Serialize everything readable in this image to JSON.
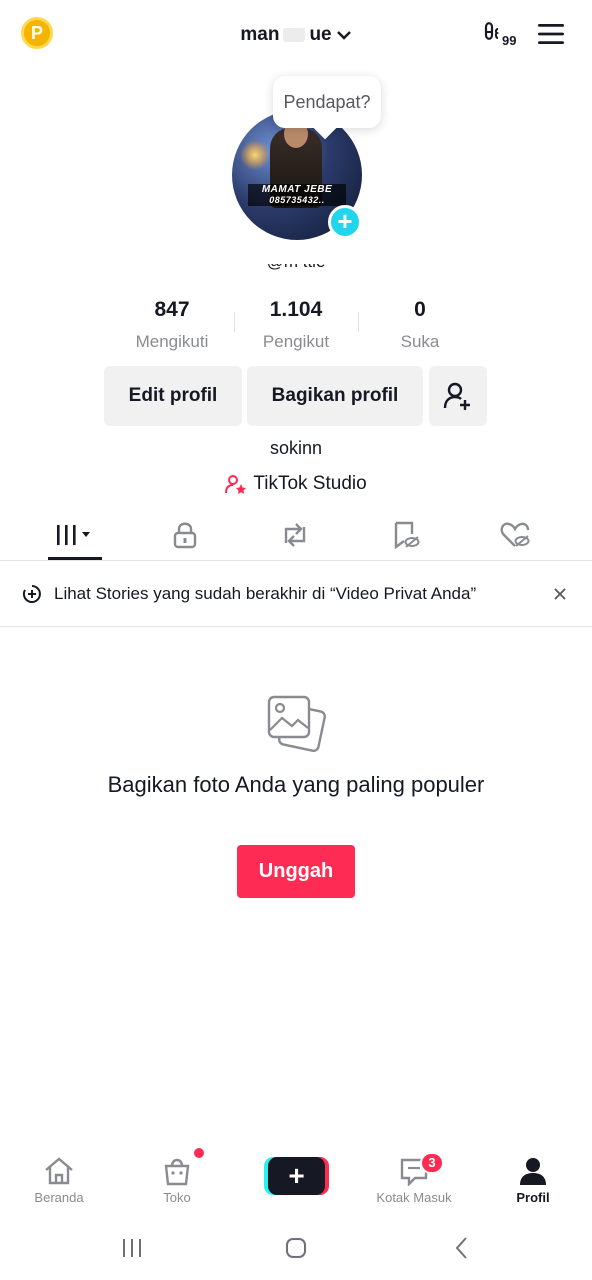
{
  "header": {
    "coin_letter": "P",
    "username_part1": "man",
    "username_part2": "ue",
    "inbox_count": "99"
  },
  "profile": {
    "tooltip": "Pendapat?",
    "avatar_banner_line1": "MAMAT JEBE",
    "avatar_banner_line2": "085735432..",
    "handle": "@m      ttle",
    "bio": "sokinn",
    "studio_label": "TikTok Studio"
  },
  "stats": [
    {
      "value": "847",
      "label": "Mengikuti"
    },
    {
      "value": "1.104",
      "label": "Pengikut"
    },
    {
      "value": "0",
      "label": "Suka"
    }
  ],
  "buttons": {
    "edit": "Edit profil",
    "share": "Bagikan profil"
  },
  "banner": {
    "text": "Lihat Stories yang sudah berakhir di “Video Privat Anda”"
  },
  "empty_state": {
    "title": "Bagikan foto Anda yang paling populer",
    "upload": "Unggah"
  },
  "nav": {
    "home": "Beranda",
    "shop": "Toko",
    "inbox": "Kotak Masuk",
    "inbox_badge": "3",
    "profile": "Profil"
  },
  "colors": {
    "accent": "#fe2c55",
    "cyan": "#20d5ec"
  }
}
